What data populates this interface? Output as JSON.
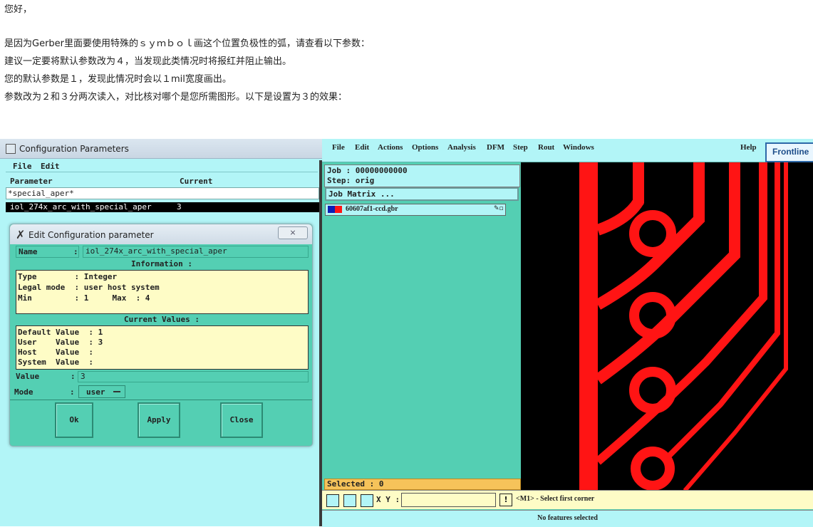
{
  "intro": {
    "line1": "您好，",
    "line2": "是因为Gerber里面要使用特殊的ｓｙｍｂｏｌ画这个位置负极性的弧，请查看以下参数：",
    "line3": "建议一定要将默认参数改为４，当发现此类情况时将报红并阻止输出。",
    "line4": "您的默认参数是１，发现此情况时会以１mil宽度画出。",
    "line5": "参数改为２和３分两次读入，对比核对哪个是您所需图形。以下是设置为３的效果："
  },
  "config_window": {
    "title": "Configuration Parameters",
    "menu": [
      "File",
      "Edit"
    ],
    "col_parameter": "Parameter",
    "col_current": "Current",
    "filter_value": "*special_aper*",
    "row_name": "iol_274x_arc_with_special_aper",
    "row_value": "3"
  },
  "edit_dialog": {
    "title": "Edit Configuration parameter",
    "close_glyph": "⨯",
    "name_label": "Name",
    "name_sep": ":",
    "name_value": "iol_274x_arc_with_special_aper",
    "information_header": "Information :",
    "info_lines": [
      "Type        : Integer",
      "Legal mode  : user host system",
      "Min         : 1     Max  : 4"
    ],
    "current_header": "Current Values :",
    "current_lines": [
      "Default Value  : 1",
      "User    Value  : 3",
      "Host    Value  :",
      "System  Value  :"
    ],
    "value_label": "Value",
    "value_sep": ":",
    "value_value": "3",
    "mode_label": "Mode",
    "mode_sep": ":",
    "mode_value": "user",
    "buttons": {
      "ok": "Ok",
      "apply": "Apply",
      "close": "Close"
    }
  },
  "frontline": {
    "menu": [
      "File",
      "Edit",
      "Actions",
      "Options",
      "Analysis",
      "DFM",
      "Step",
      "Rout",
      "Windows"
    ],
    "help": "Help",
    "logo": "Frontline",
    "job": "Job : 00000000000",
    "step": "Step: orig",
    "job_matrix": "Job Matrix ...",
    "layer_name": "60607af1-ccd.gbr",
    "selected": "Selected : 0",
    "xy_label": "X Y :",
    "xy_value": "",
    "hint": "<M1> - Select first corner",
    "status": "No features selected"
  },
  "colors": {
    "cyan_bg": "#b2f5f7",
    "teal_bg": "#54cfb3",
    "cream": "#fefcc6",
    "trace_red": "#ff1414",
    "canvas_bg": "#000000"
  }
}
